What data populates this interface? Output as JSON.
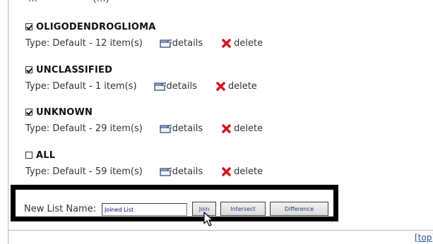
{
  "lists": [
    {
      "name": "OLIGODENDROGLIOMA",
      "checked": true,
      "type_text": "Type: Default - 12 item(s)",
      "details_label": "details",
      "delete_label": "delete"
    },
    {
      "name": "UNCLASSIFIED",
      "checked": true,
      "type_text": "Type: Default - 1 item(s)",
      "details_label": "details",
      "delete_label": "delete"
    },
    {
      "name": "UNKNOWN",
      "checked": true,
      "type_text": "Type: Default - 29 item(s)",
      "details_label": "details",
      "delete_label": "delete"
    },
    {
      "name": "ALL",
      "checked": false,
      "type_text": "Type: Default - 59 item(s)",
      "details_label": "details",
      "delete_label": "delete"
    }
  ],
  "join_form": {
    "label": "New List Name:",
    "input_value": "Joined List",
    "join_label": "Join",
    "intersect_label": "Intersect",
    "difference_label": "Difference"
  },
  "footer": {
    "top_link": "[top]"
  },
  "colors": {
    "delete_icon": "#d0141e",
    "link": "#2a4f9e",
    "button_text": "#1e3f7c"
  },
  "icons": {
    "details": "folder-details-icon",
    "delete": "red-x-icon",
    "cursor": "mouse-pointer-icon"
  }
}
